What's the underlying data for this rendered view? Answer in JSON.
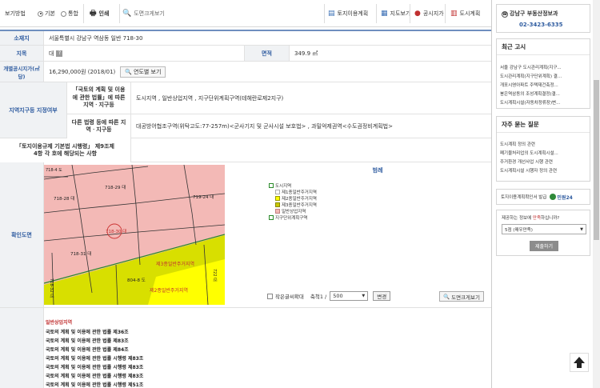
{
  "toolbar": {
    "view_label": "보기방법",
    "opt_basic": "기본",
    "opt_combined": "통합",
    "print": "인쇄",
    "map_zoom": "도면크게보기",
    "link_cadastre": "토지이용계획",
    "link_mapview": "지도보기",
    "link_price": "공시지가",
    "link_urban": "도시계획"
  },
  "land": {
    "addr_label": "소재지",
    "addr_value": "서울특별시 강남구 역삼동 일반 718-30",
    "jimok_label": "지목",
    "jimok_value": "대",
    "area_label": "면적",
    "area_value": "349.9 ㎡",
    "price_label": "개별공시지가(㎡당)",
    "price_value": "16,290,000원 (2018/01)",
    "price_button": "연도별 보기",
    "zone_label": "지역지구등 지정여부",
    "zone_sub1": "「국토의 계획 및 이용에 관한 법률」에 따른 지역ㆍ지구등",
    "zone_val1": "도시지역 , 일반상업지역 , 지구단위계획구역(테헤란로제2지구)",
    "zone_sub2": "다른 법령 등에 따른 지역ㆍ지구등",
    "zone_val2": "대공방어협조구역(위탁고도:77-257m)<군사기지 및 군사시설 보호법> , 과밀억제권역<수도권정비계획법>",
    "reg_label": "「토지이용규제 기본법 시행령」 제9조제4항 각 호에 해당되는 사항",
    "reg_value": "",
    "map_label": "확인도면"
  },
  "map": {
    "parcels": [
      "718-29 대",
      "718-28 대",
      "719-24 대",
      "718-30 대",
      "718-31 대",
      "804-8 도",
      "718-32 대",
      "718-4 도",
      "722 대"
    ],
    "zone1": "제3종일반주거지역",
    "zone2": "제2종일반주거지역",
    "colors": {
      "pink": "#f3b9b6",
      "yellow": "#d8df00",
      "lime": "#ffff00"
    }
  },
  "legend": {
    "title": "범례",
    "items": [
      {
        "label": "도시지역",
        "color": "#ffffff",
        "border": "#2a8a2a"
      },
      {
        "label": "제1종일반주거지역",
        "color": "#ffffff",
        "border": "#aaaaaa"
      },
      {
        "label": "제2종일반주거지역",
        "color": "#ffff00",
        "border": "#999900"
      },
      {
        "label": "제3종일반주거지역",
        "color": "#c8c800",
        "border": "#888800"
      },
      {
        "label": "일반상업지역",
        "color": "#f3b9b6",
        "border": "#c08080"
      },
      {
        "label": "지구단위계획구역",
        "color": "#ffffff",
        "border": "#2a8a2a"
      }
    ],
    "small_label": "작은글씨확대",
    "scale_label": "축척1 /",
    "scale_value": "500",
    "change_button": "변경",
    "zoom_button": "도면크게보기"
  },
  "laws": {
    "heading": "일반상업지역",
    "items": [
      "국토의 계획 및 이용에 관한 법률 제36조",
      "국토의 계획 및 이용에 관한 법률 제83조",
      "국토의 계획 및 이용에 관한 법률 제84조",
      "국토의 계획 및 이용에 관한 법률 시행령 제83조",
      "국토의 계획 및 이용에 관한 법률 시행령 제83조",
      "국토의 계획 및 이용에 관한 법률 시행령 제83조",
      "국토의 계획 및 이용에 관한 법률 시행령 제51조"
    ]
  },
  "right": {
    "office": "강남구 부동산정보과",
    "phone": "02-3423-6335",
    "notice_title": "최근 고시",
    "notices": [
      "서울 강남구 도시관리계획(지구...",
      "도시관리계획(지구단위계획) 결...",
      "개포시영아파트 주택재건축정...",
      "봉은역삼동의 조성계획결정(결...",
      "도시계획시설(자동차정류장)변..."
    ],
    "faq_title": "자주 묻는 질문",
    "faqs": [
      "도시계획 정의 관련",
      "폐기물처리업의 도시계획시설...",
      "주거환경 개선사업 시행 관련",
      "도시계획시설 시행자 정의 관련"
    ],
    "cert_text": "토지이용계획확인서 발급",
    "cert_logo": "민원24",
    "survey_q1": "제공하는 정보에 ",
    "survey_q2": "만족",
    "survey_q3": "하십니까?",
    "survey_select": "5점 (매우만족)",
    "survey_button": "제출하기"
  }
}
